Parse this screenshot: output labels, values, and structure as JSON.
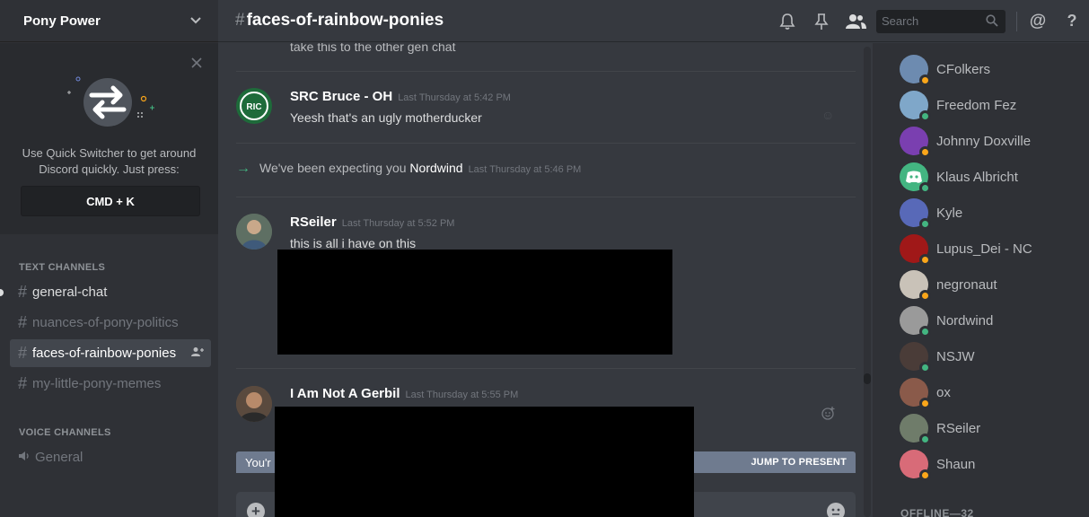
{
  "server": {
    "name": "Pony Power"
  },
  "quick_switcher": {
    "text": "Use Quick Switcher to get around Discord quickly. Just press:",
    "shortcut": "CMD + K"
  },
  "categories": {
    "text": "TEXT CHANNELS",
    "voice": "VOICE CHANNELS"
  },
  "text_channels": [
    {
      "name": "general-chat",
      "state": "unread"
    },
    {
      "name": "nuances-of-pony-politics",
      "state": "normal"
    },
    {
      "name": "faces-of-rainbow-ponies",
      "state": "selected"
    },
    {
      "name": "my-little-pony-memes",
      "state": "normal"
    }
  ],
  "voice_channels": [
    {
      "name": "General"
    }
  ],
  "header": {
    "channel": "faces-of-rainbow-ponies",
    "search_placeholder": "Search",
    "icons": [
      "bell-icon",
      "pin-icon",
      "members-icon",
      "search-icon",
      "at-icon",
      "help-icon"
    ]
  },
  "messages": {
    "partial_top": "take this to the other gen chat",
    "items": [
      {
        "author": "SRC Bruce - OH",
        "timestamp": "Last Thursday at 5:42 PM",
        "text": "Yeesh that's an ugly motherducker"
      },
      {
        "author": "RSeiler",
        "timestamp": "Last Thursday at 5:52 PM",
        "text": "this is all i have on this"
      },
      {
        "author": "I Am Not A Gerbil",
        "timestamp": "Last Thursday at 5:55 PM",
        "text": ""
      }
    ],
    "system": {
      "prefix": "We've been expecting you",
      "user": "Nordwind",
      "timestamp": "Last Thursday at 5:46 PM"
    }
  },
  "jump_bar": {
    "text": "You'r",
    "action": "JUMP TO PRESENT"
  },
  "members": [
    {
      "name": "CFolkers",
      "status": "idle",
      "status_color": "#faa61a",
      "avatar_color": "#6d8bb0"
    },
    {
      "name": "Freedom Fez",
      "status": "online",
      "status_color": "#43b581",
      "avatar_color": "#7fa7c9"
    },
    {
      "name": "Johnny Doxville",
      "status": "idle",
      "status_color": "#faa61a",
      "avatar_color": "#7a3fb0"
    },
    {
      "name": "Klaus Albricht",
      "status": "online",
      "status_color": "#43b581",
      "avatar_color": "#43b581"
    },
    {
      "name": "Kyle",
      "status": "online",
      "status_color": "#43b581",
      "avatar_color": "#5869b8"
    },
    {
      "name": "Lupus_Dei - NC",
      "status": "idle",
      "status_color": "#faa61a",
      "avatar_color": "#a01818"
    },
    {
      "name": "negronaut",
      "status": "idle",
      "status_color": "#faa61a",
      "avatar_color": "#c9c2b8"
    },
    {
      "name": "Nordwind",
      "status": "online",
      "status_color": "#43b581",
      "avatar_color": "#9a9a9a"
    },
    {
      "name": "NSJW",
      "status": "online",
      "status_color": "#43b581",
      "avatar_color": "#4a3c38"
    },
    {
      "name": "ox",
      "status": "idle",
      "status_color": "#faa61a",
      "avatar_color": "#8a5a4a"
    },
    {
      "name": "RSeiler",
      "status": "online",
      "status_color": "#43b581",
      "avatar_color": "#6f7c6a"
    },
    {
      "name": "Shaun",
      "status": "idle",
      "status_color": "#faa61a",
      "avatar_color": "#d86b78"
    }
  ],
  "offline_label": "OFFLINE—32"
}
